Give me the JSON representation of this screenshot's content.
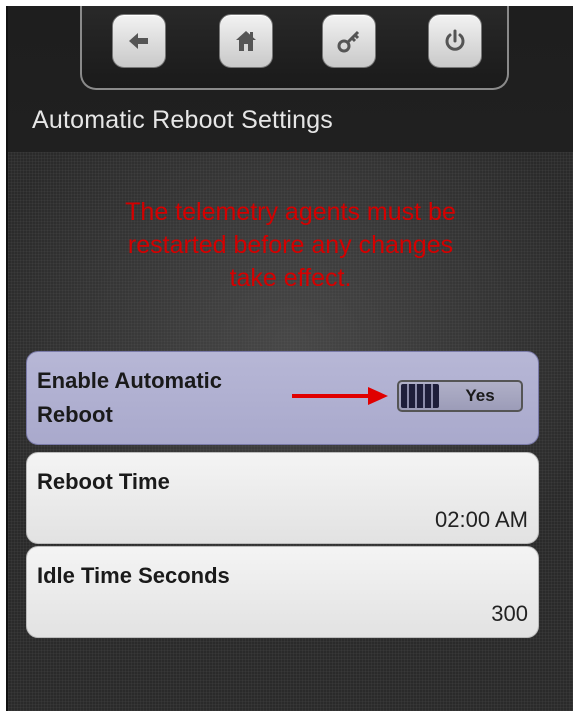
{
  "nav": {
    "buttons": [
      {
        "icon": "back-arrow-icon"
      },
      {
        "icon": "home-icon"
      },
      {
        "icon": "key-icon"
      },
      {
        "icon": "power-icon"
      }
    ]
  },
  "header": {
    "title": "Automatic Reboot Settings"
  },
  "warning": {
    "line1": "The telemetry agents must be",
    "line2": "restarted before any changes",
    "line3": "take effect."
  },
  "settings": [
    {
      "label_line1": "Enable Automatic",
      "label_line2": "Reboot",
      "toggle_value": "Yes"
    },
    {
      "label": "Reboot Time",
      "value": "02:00 AM"
    },
    {
      "label": "Idle Time Seconds",
      "value": "300"
    }
  ],
  "colors": {
    "warning_text": "#d40000",
    "selected_row": "#b1b1d1",
    "annotation_arrow": "#e00000"
  }
}
